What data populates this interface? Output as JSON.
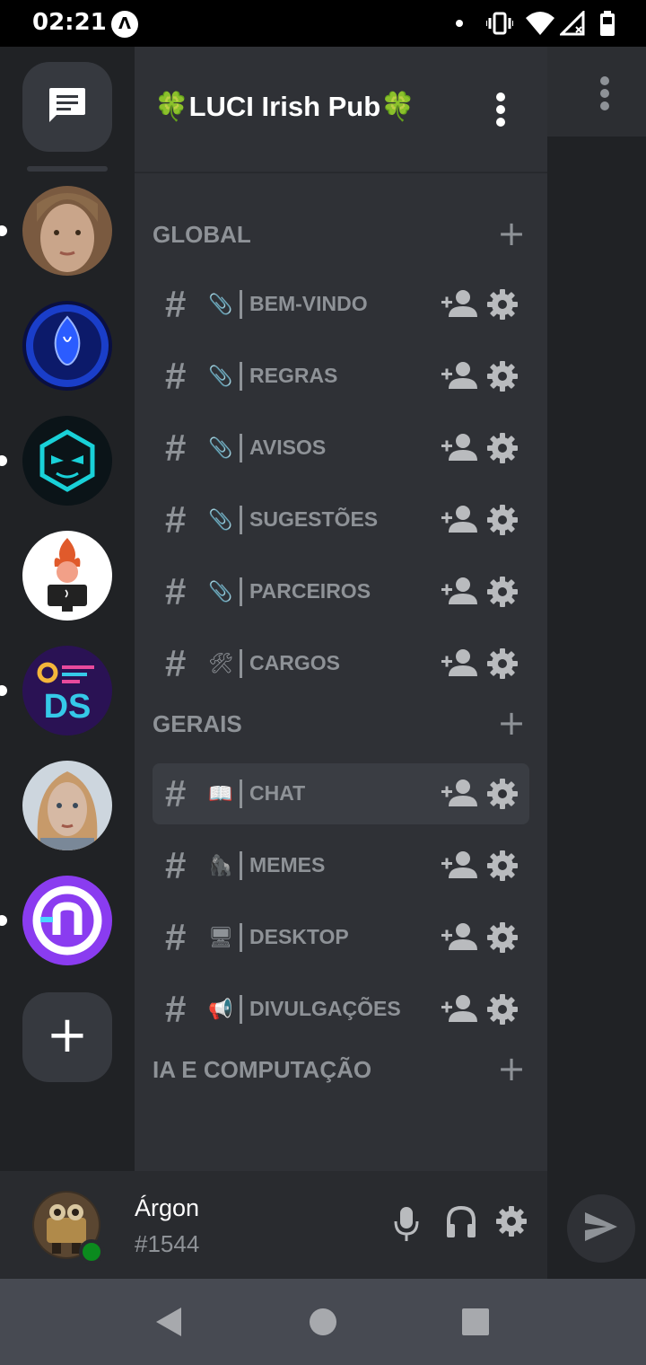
{
  "status_bar": {
    "time": "02:21",
    "icons": [
      "app-logo-icon",
      "notification-dot-icon",
      "vibrate-icon",
      "wifi-icon",
      "no-signal-icon",
      "battery-icon"
    ]
  },
  "servers": [
    {
      "name": "server-avatar-girl",
      "unread": true,
      "colors": [
        "#c9a58a",
        "#7a5a40"
      ]
    },
    {
      "name": "server-avatar-blue-phoenix",
      "unread": false,
      "colors": [
        "#1a3ec9",
        "#0a0f40"
      ]
    },
    {
      "name": "server-avatar-cyan-mask",
      "unread": true,
      "colors": [
        "#0b1418",
        "#19d1d8"
      ]
    },
    {
      "name": "server-avatar-fire-coder",
      "unread": false,
      "colors": [
        "#ffffff",
        "#e05a2b"
      ]
    },
    {
      "name": "server-avatar-ds",
      "unread": true,
      "colors": [
        "#2a1254",
        "#35c9e8"
      ]
    },
    {
      "name": "server-avatar-warrior-woman",
      "unread": false,
      "colors": [
        "#d6b9a4",
        "#6a4b3a"
      ]
    },
    {
      "name": "server-avatar-purple-n",
      "unread": true,
      "colors": [
        "#8a3cf0",
        "#ffffff"
      ]
    }
  ],
  "server": {
    "title": "🍀LUCI Irish Pub🍀"
  },
  "categories": [
    {
      "label": "GLOBAL",
      "channels": [
        {
          "emoji": "📎",
          "name": "BEM-VINDO",
          "active": false
        },
        {
          "emoji": "📎",
          "name": "REGRAS",
          "active": false
        },
        {
          "emoji": "📎",
          "name": "AVISOS",
          "active": false
        },
        {
          "emoji": "📎",
          "name": "SUGESTÕES",
          "active": false
        },
        {
          "emoji": "📎",
          "name": "PARCEIROS",
          "active": false
        },
        {
          "emoji": "🛠",
          "name": "CARGOS",
          "active": false
        }
      ]
    },
    {
      "label": "GERAIS",
      "channels": [
        {
          "emoji": "📖",
          "name": "CHAT",
          "active": true
        },
        {
          "emoji": "🦍",
          "name": "MEMES",
          "active": false
        },
        {
          "emoji": "🖥",
          "name": "DESKTOP",
          "active": false
        },
        {
          "emoji": "📢",
          "name": "DIVULGAÇÕES",
          "active": false
        }
      ]
    },
    {
      "label": "IA E COMPUTAÇÃO",
      "channels": []
    }
  ],
  "user": {
    "name": "Árgon",
    "tag": "#1544",
    "status_color": "#0b8a1e"
  },
  "colors": {
    "rail_bg": "#202225",
    "panel_bg": "#2f3136",
    "userbar_bg": "#292b2f",
    "muted_text": "#8e9297",
    "active_channel_bg": "#3a3d43"
  }
}
